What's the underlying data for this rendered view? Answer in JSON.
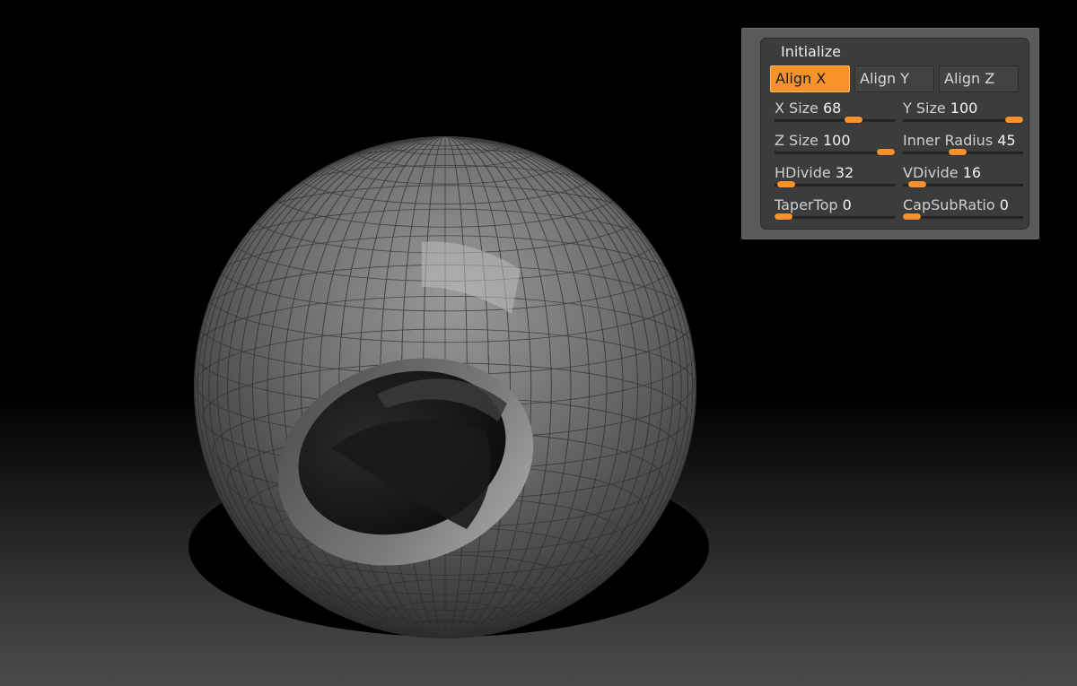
{
  "panel": {
    "title": "Initialize",
    "align_buttons": [
      {
        "label": "Align X",
        "active": true
      },
      {
        "label": "Align Y",
        "active": false
      },
      {
        "label": "Align Z",
        "active": false
      }
    ],
    "sliders": [
      {
        "label": "X Size",
        "value": "68",
        "level": 0.68
      },
      {
        "label": "Y Size",
        "value": "100",
        "level": 1.0
      },
      {
        "label": "Z Size",
        "value": "100",
        "level": 1.0
      },
      {
        "label": "Inner Radius",
        "value": "45",
        "level": 0.45
      },
      {
        "label": "HDivide",
        "value": "32",
        "level": 0.03
      },
      {
        "label": "VDivide",
        "value": "16",
        "level": 0.05
      },
      {
        "label": "TaperTop",
        "value": "0",
        "level": 0.0
      },
      {
        "label": "CapSubRatio",
        "value": "0",
        "level": 0.0
      }
    ]
  },
  "colors": {
    "accent": "#f7932a",
    "panel_bg": "#3c3c3c",
    "viewport_bg": "#000000"
  }
}
